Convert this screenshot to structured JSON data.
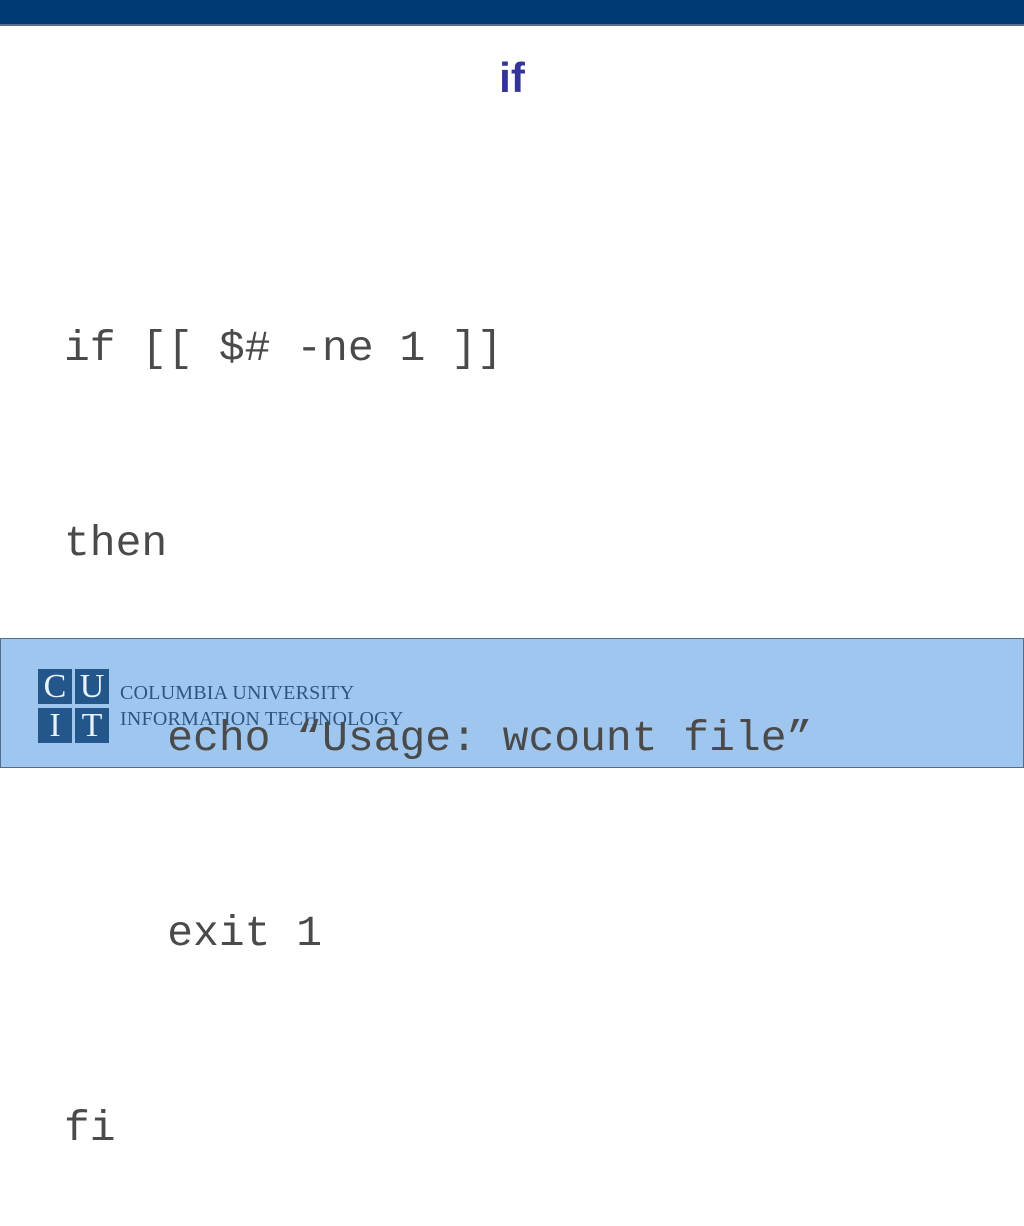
{
  "slide": {
    "title": "if",
    "code_lines": [
      "if [[ $# -ne 1 ]]",
      "then",
      "    echo “Usage: wcount file”",
      "    exit 1",
      "fi"
    ]
  },
  "footer": {
    "logo_letters": [
      "C",
      "U",
      "I",
      "T"
    ],
    "org_line1": "COLUMBIA UNIVERSITY",
    "org_line2": "INFORMATION TECHNOLOGY"
  },
  "colors": {
    "top_bar": "#003a74",
    "title": "#333399",
    "footer": "#9ec6ef",
    "logo": "#23568a"
  }
}
